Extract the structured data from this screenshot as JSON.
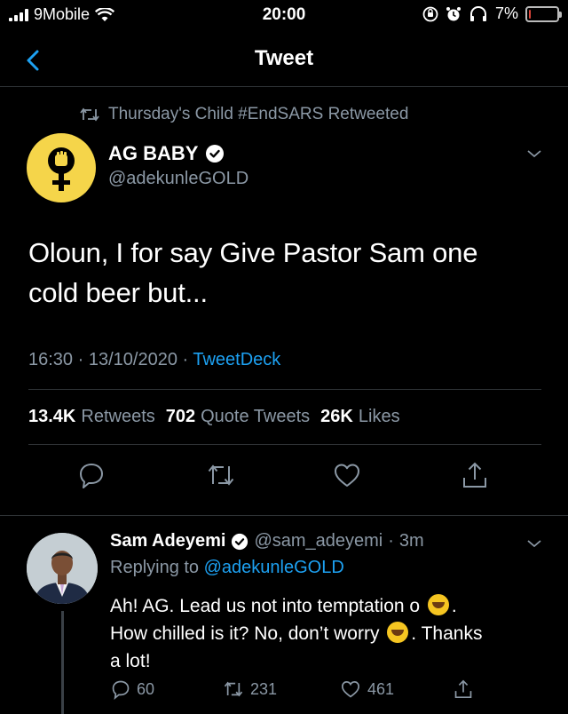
{
  "status_bar": {
    "carrier": "9Mobile",
    "time": "20:00",
    "battery": "7%",
    "battery_level": 0.07,
    "icons": [
      "signal-icon",
      "wifi-icon",
      "rotation-lock-icon",
      "alarm-icon",
      "headphones-icon",
      "battery-icon"
    ]
  },
  "nav": {
    "title": "Tweet",
    "back_icon": "chevron-left-icon"
  },
  "retweet_context": {
    "text": "Thursday's Child #EndSARS Retweeted",
    "icon": "retweet-icon"
  },
  "tweet": {
    "author_name": "AG BABY",
    "author_handle": "@adekunleGOLD",
    "verified": true,
    "text_line1": "Oloun, I for say Give Pastor Sam one",
    "text_line2": "cold beer but...",
    "time": "16:30",
    "date": "13/10/2020",
    "source": "TweetDeck",
    "retweets_count": "13.4K",
    "retweets_label": "Retweets",
    "quotes_count": "702",
    "quotes_label": "Quote Tweets",
    "likes_count": "26K",
    "likes_label": "Likes",
    "avatar_color": "#f5d54a"
  },
  "reply": {
    "author_name": "Sam Adeyemi",
    "author_handle": "@sam_adeyemi",
    "time_ago": "3m",
    "replying_label": "Replying to",
    "replying_to": "@adekunleGOLD",
    "text_part1": "Ah! AG. Lead us not into temptation o",
    "text_part2": ".",
    "text_part3": "How chilled is it? No, don’t worry",
    "text_part4": ". Thanks",
    "text_part5": "a lot!",
    "reply_count": "60",
    "retweet_count": "231",
    "like_count": "461"
  },
  "colors": {
    "accent": "#1da1f2",
    "secondary_text": "#8b98a5",
    "divider": "#2f3336",
    "background": "#000000"
  }
}
